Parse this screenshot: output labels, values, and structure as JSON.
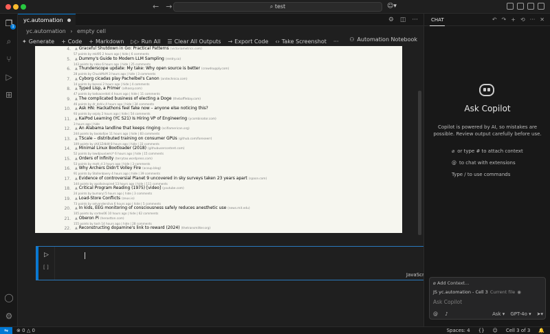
{
  "window": {
    "search_text": "test"
  },
  "activity_bar": {
    "items": [
      {
        "name": "explorer-icon",
        "glyph": "❐",
        "badge": "1"
      },
      {
        "name": "search-icon",
        "glyph": "⌕"
      },
      {
        "name": "source-control-icon",
        "glyph": "⑂"
      },
      {
        "name": "run-debug-icon",
        "glyph": "▷"
      },
      {
        "name": "extensions-icon",
        "glyph": "⊞"
      }
    ],
    "bottom": [
      {
        "name": "account-icon",
        "glyph": "◯"
      },
      {
        "name": "settings-gear-icon",
        "glyph": "⚙"
      }
    ]
  },
  "editor": {
    "tab_label": "yc.automation",
    "breadcrumb": {
      "file": "yc.automation",
      "cell": "empty cell"
    },
    "toolbar": {
      "generate": "Generate",
      "code": "Code",
      "markdown": "Markdown",
      "run_all": "Run All",
      "clear_outputs": "Clear All Outputs",
      "export_code": "Export Code",
      "take_screenshot": "Take Screenshot",
      "more": "···",
      "kernel": "Automation Notebook"
    },
    "cell": {
      "count": "[ ]",
      "language": "JavaScript"
    }
  },
  "hn_items": [
    {
      "num": "4.",
      "title": "Graceful Shutdown in Go: Practical Patterns",
      "site": "(victoriametrics.com)",
      "sub": "57 points by mkl95 2 hours ago | hide | 6 comments"
    },
    {
      "num": "5.",
      "title": "Dummy's Guide to Modern LLM Sampling",
      "site": "(rentry.co)",
      "sub": "143 points by nkko 6 hours ago | hide | 25 comments"
    },
    {
      "num": "6.",
      "title": "Thunderscope update: My take: Why open source is better",
      "site": "(crowdsupply.com)",
      "sub": "28 points by ChuckMcM 3 hours ago | hide | 3 comments"
    },
    {
      "num": "7.",
      "title": "Cyborg cicadas play Pachelbel's Canon",
      "site": "(arstechnica.com)",
      "sub": "14 points by bonsai 2 hours ago | hide | 4 comments"
    },
    {
      "num": "8.",
      "title": "Typed Lisp, a Primer",
      "site": "(alhassy.com)",
      "sub": "47 points by todsacerdoti 4 hours ago | hide | 11 comments"
    },
    {
      "num": "9.",
      "title": "The complicated business of electing a Doge",
      "site": "(thebafflebay.com)",
      "sub": "46 points by dr_dshiv 4 hours ago | hide | 34 comments"
    },
    {
      "num": "10.",
      "title": "Ask HN: Hackathons feel fake now – anyone else noticing this?",
      "site": "",
      "sub": "93 points by sejaly 2 hours ago | hide | 54 comments"
    },
    {
      "num": "11.",
      "title": "KaiPod Learning (YC S21) Is Hiring VP of Engineering",
      "site": "(ycombinator.com)",
      "sub": "3 hours ago | hide"
    },
    {
      "num": "12.",
      "title": "An Alabama landline that keeps ringing",
      "site": "(scifiamerican.org)",
      "sub": "244 points by bookofjoe 11 hours ago | hide | 83 comments"
    },
    {
      "num": "13.",
      "title": "TScale – distributed training on consumer GPUs",
      "site": "(github.com/foreseerr)",
      "sub": "109 points by zX41ZdbW 8 hours ago | hide | 33 comments"
    },
    {
      "num": "14.",
      "title": "Minimal Linux Bootloader (2018)",
      "site": "(githubusercontent.com)",
      "sub": "52 points by lowdjoux(wm)* 6 hours ago | hide | 15 comments"
    },
    {
      "num": "15.",
      "title": "Orders of Infinity",
      "site": "(terrytao.wordpress.com)",
      "sub": "53 points by matt_d 3 hours ago | hide | 3 comments"
    },
    {
      "num": "16.",
      "title": "Why Archers Didn't Volley Fire",
      "site": "(acoup.blog)",
      "sub": "91 points by Stollenbaery 4 hours ago | hide | 39 comments"
    },
    {
      "num": "17.",
      "title": "Evidence of controversial Planet 9 uncovered in sky surveys taken 23 years apart",
      "site": "(space.com)",
      "sub": "144 points by apolloinspired 13 hours ago | hide | 111 comments"
    },
    {
      "num": "18.",
      "title": "Critical Program Reading (1975) [video]",
      "site": "(youtube.com)",
      "sub": "24 points by bumaryl 5 hours ago | hide | 3 comments"
    },
    {
      "num": "19.",
      "title": "Load-Store Conflicts",
      "site": "(zeux.io)",
      "sub": "73 points by selvandersilva 6 hours ago | hide | 5 comments"
    },
    {
      "num": "20.",
      "title": "In kids, EEG monitoring of consciousness safely reduces anesthetic use",
      "site": "(news.mit.edu)",
      "sub": "105 points by cortex06 10 hours ago | hide | 62 comments"
    },
    {
      "num": "21.",
      "title": "Oberon Pi",
      "site": "(heroxtton.com)",
      "sub": "155 points by tosh 14 hours ago | hide | 28 comments"
    },
    {
      "num": "22.",
      "title": "Reconstructing dopamine's link to reward (2024)",
      "site": "(thetransmitter.org)",
      "sub": ""
    }
  ],
  "chat": {
    "tab_label": "CHAT",
    "title": "Ask Copilot",
    "description": "Copilot is powered by AI, so mistakes are possible. Review output carefully before use.",
    "hints": [
      {
        "icon": "paperclip-icon",
        "glyph": "⌀",
        "text": "or type # to attach context"
      },
      {
        "icon": "at-icon",
        "glyph": "@",
        "text": "to chat with extensions"
      },
      {
        "icon": "slash-icon",
        "glyph": "",
        "text": "Type / to use commands"
      }
    ],
    "input": {
      "add_context": "Add Context...",
      "current_file": "yc.automation - Cell 3",
      "current_file_label": "Current file",
      "placeholder": "Ask Copilot",
      "mode": "Ask",
      "model": "GPT-4o"
    }
  },
  "status": {
    "errors": "0",
    "warnings": "0",
    "spaces": "Spaces: 4",
    "braces": "{}",
    "cell_position": "Cell 3 of 3"
  }
}
